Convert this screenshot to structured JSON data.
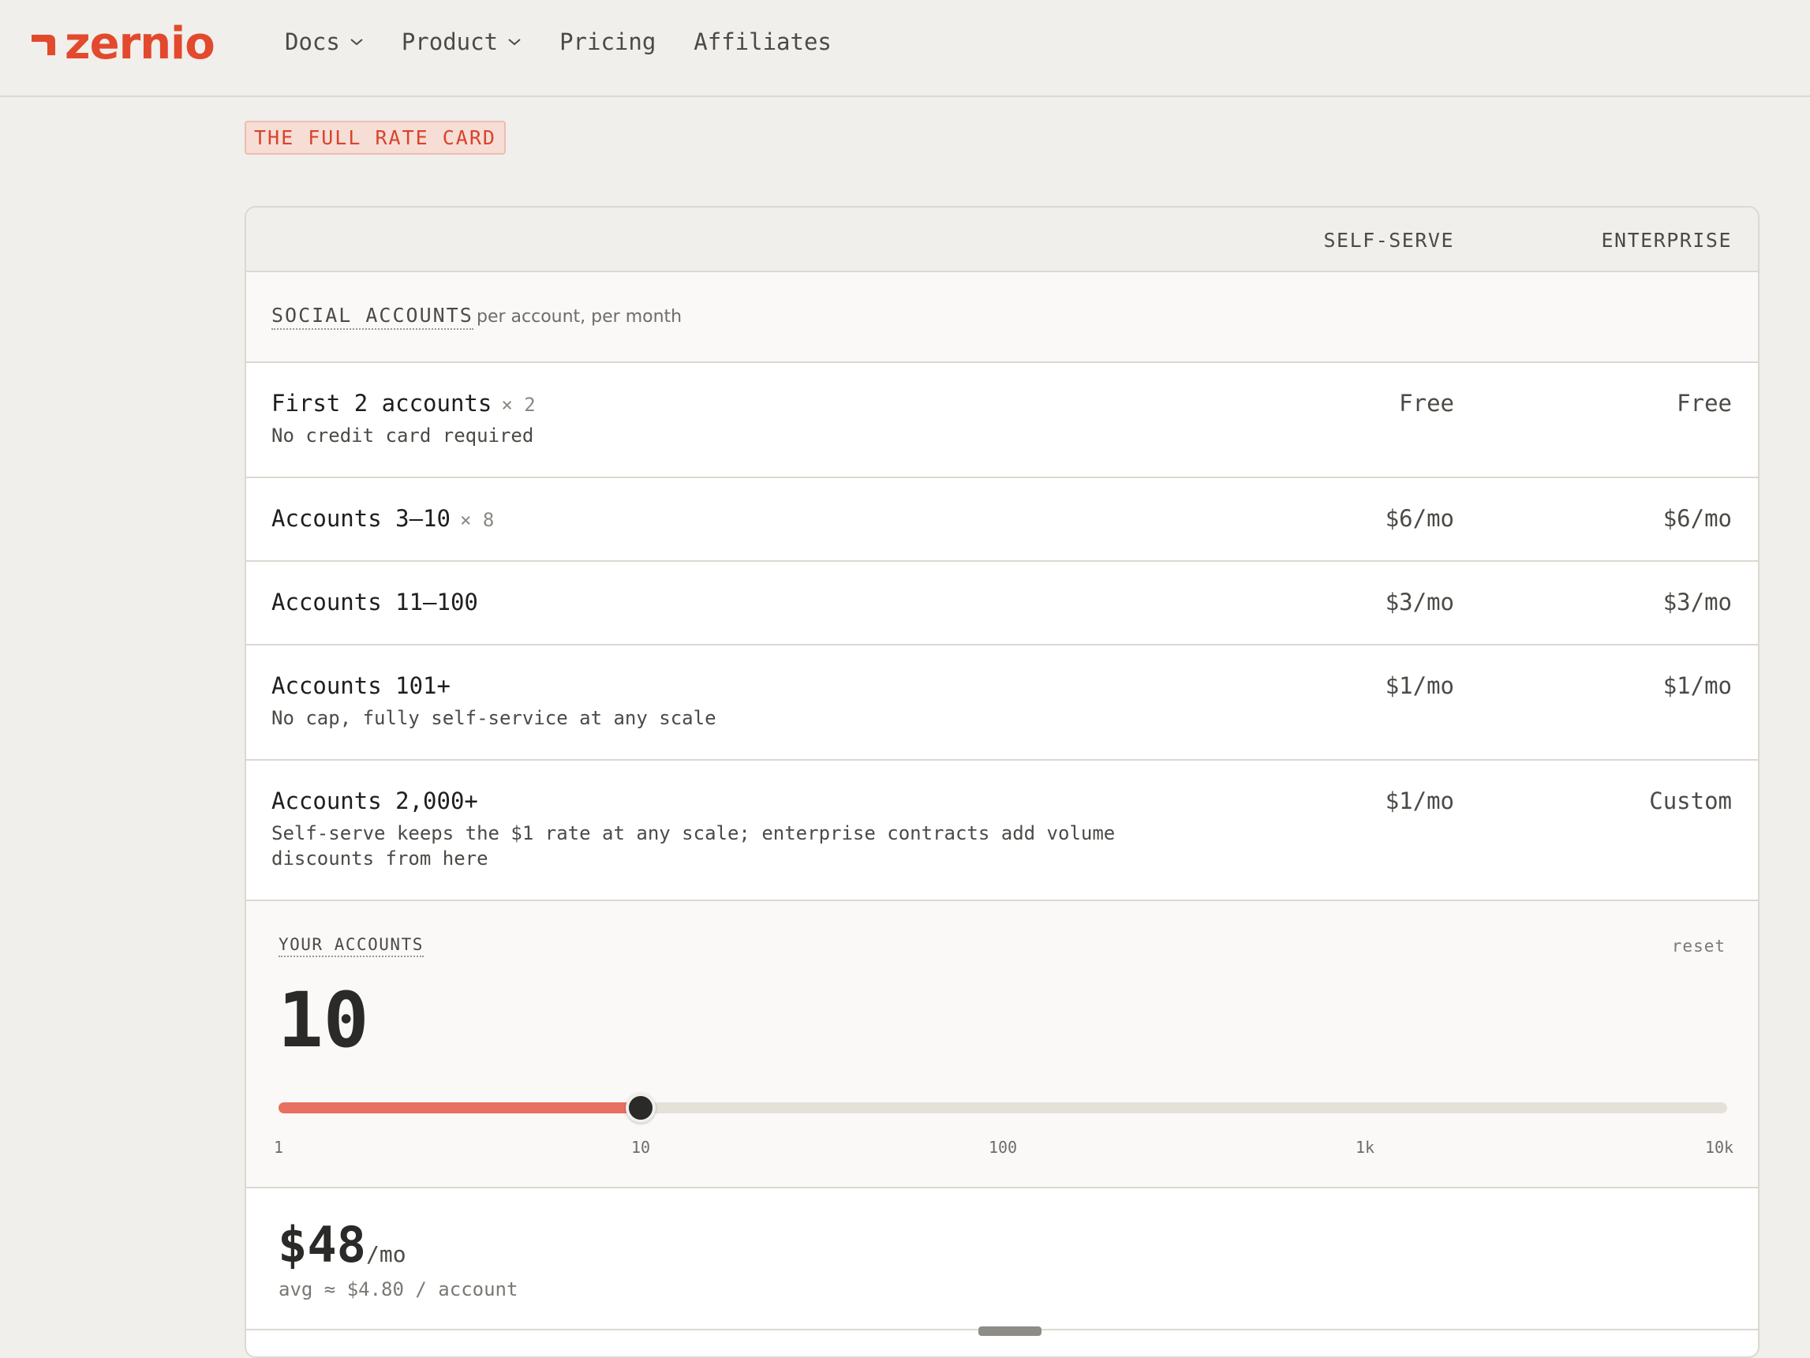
{
  "brand": {
    "name": "zernio",
    "color": "#e2492d"
  },
  "nav": {
    "items": [
      {
        "label": "Docs",
        "dropdown": true
      },
      {
        "label": "Product",
        "dropdown": true
      },
      {
        "label": "Pricing",
        "dropdown": false
      },
      {
        "label": "Affiliates",
        "dropdown": false
      }
    ]
  },
  "tag": "THE FULL RATE CARD",
  "table": {
    "columns": {
      "self_serve": "SELF-SERVE",
      "enterprise": "ENTERPRISE"
    },
    "section": {
      "title": "SOCIAL ACCOUNTS",
      "subtitle": "· per account, per month"
    },
    "rows": [
      {
        "title": "First 2 accounts",
        "mult": "× 2",
        "desc": "No credit card required",
        "self_serve": "Free",
        "enterprise": "Free"
      },
      {
        "title": "Accounts 3–10",
        "mult": "× 8",
        "desc": "",
        "self_serve": "$6/mo",
        "enterprise": "$6/mo"
      },
      {
        "title": "Accounts 11–100",
        "mult": "",
        "desc": "",
        "self_serve": "$3/mo",
        "enterprise": "$3/mo"
      },
      {
        "title": "Accounts 101+",
        "mult": "",
        "desc": "No cap, fully self-service at any scale",
        "self_serve": "$1/mo",
        "enterprise": "$1/mo"
      },
      {
        "title": "Accounts 2,000+",
        "mult": "",
        "desc": "Self-serve keeps the $1 rate at any scale; enterprise contracts add volume discounts from here",
        "self_serve": "$1/mo",
        "enterprise": "Custom"
      }
    ]
  },
  "calculator": {
    "label": "YOUR ACCOUNTS",
    "reset": "reset",
    "count": "10",
    "slider_fraction": 0.25,
    "ticks": [
      "1",
      "10",
      "100",
      "1k",
      "10k"
    ],
    "accent": "#e87060"
  },
  "total": {
    "amount": "$48",
    "unit": "/mo",
    "avg": "avg ≈ $4.80 / account"
  }
}
